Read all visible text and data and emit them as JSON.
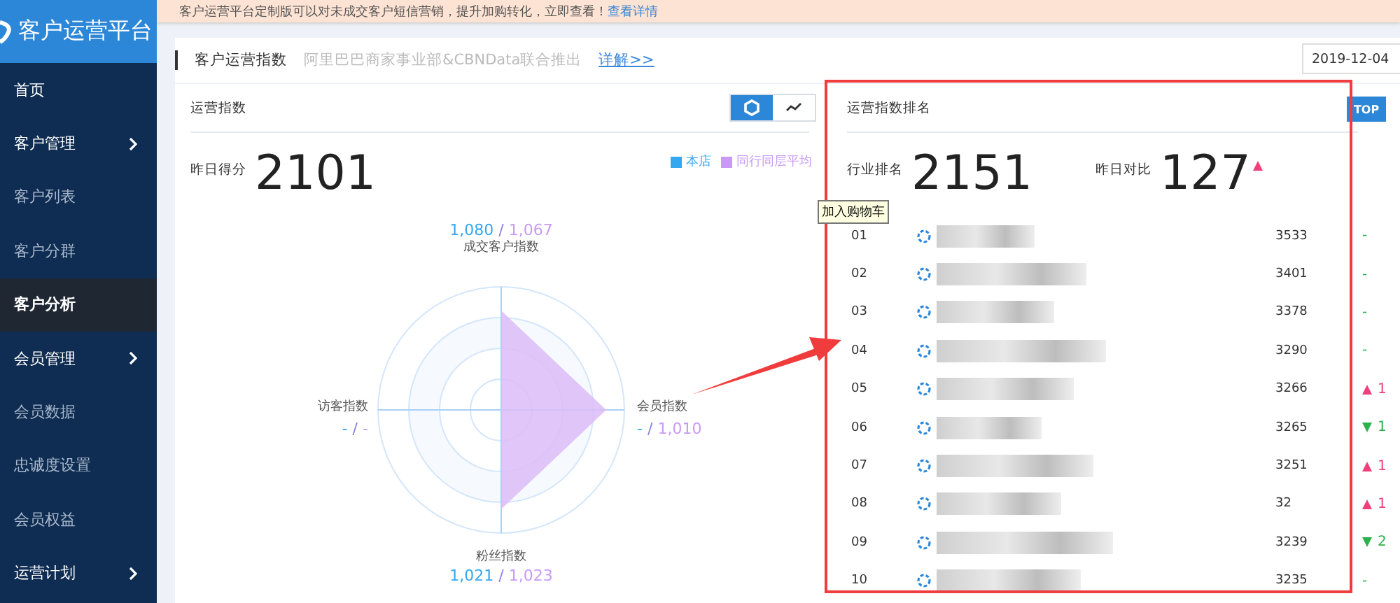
{
  "sidebar": {
    "title": "客户运营平台",
    "items": [
      {
        "label": "首页",
        "kind": "top",
        "expandable": false,
        "selected": false
      },
      {
        "label": "客户管理",
        "kind": "top",
        "expandable": true,
        "selected": false
      },
      {
        "label": "客户列表",
        "kind": "sub",
        "expandable": false,
        "selected": false
      },
      {
        "label": "客户分群",
        "kind": "sub",
        "expandable": false,
        "selected": false
      },
      {
        "label": "客户分析",
        "kind": "sub",
        "expandable": false,
        "selected": true
      },
      {
        "label": "会员管理",
        "kind": "top",
        "expandable": true,
        "selected": false
      },
      {
        "label": "会员数据",
        "kind": "sub",
        "expandable": false,
        "selected": false
      },
      {
        "label": "忠诚度设置",
        "kind": "sub",
        "expandable": false,
        "selected": false
      },
      {
        "label": "会员权益",
        "kind": "sub",
        "expandable": false,
        "selected": false
      },
      {
        "label": "运营计划",
        "kind": "top",
        "expandable": true,
        "selected": false
      }
    ]
  },
  "banner": {
    "text": "客户运营平台定制版可以对未成交客户短信营销，提升加购转化，立即查看！",
    "link": "查看详情"
  },
  "header": {
    "title": "客户运营指数",
    "subtitle": "阿里巴巴商家事业部&CBNData联合推出",
    "link": "详解>>",
    "date": "2019-12-04"
  },
  "index_panel": {
    "title": "运营指数",
    "view_toggle": [
      {
        "kind": "radar",
        "selected": true
      },
      {
        "kind": "line",
        "selected": false
      }
    ],
    "score_label": "昨日得分",
    "score": "2101",
    "legend": [
      {
        "label": "本店",
        "color": "#35a7f0"
      },
      {
        "label": "同行同层平均",
        "color": "#c99af5"
      }
    ],
    "axes": [
      {
        "kind": "top",
        "label": "成交客户指数",
        "shop": "1,080",
        "separator": "/",
        "peer": "1,067"
      },
      {
        "kind": "left",
        "label": "访客指数",
        "shop": "-",
        "separator": "/",
        "peer": "-"
      },
      {
        "kind": "right",
        "label": "会员指数",
        "shop": "-",
        "separator": "/",
        "peer": "1,010"
      },
      {
        "kind": "bottom",
        "label": "粉丝指数",
        "shop": "1,021",
        "separator": "/",
        "peer": "1,023"
      }
    ]
  },
  "rank_panel": {
    "title": "运营指数排名",
    "top_button": {
      "label": "TOP",
      "selected": true
    },
    "rank_label": "行业排名",
    "rank": "2151",
    "compare_label": "昨日对比",
    "compare": "127",
    "compare_up": true,
    "rows": [
      {
        "rank": "01",
        "score": "3533",
        "kind": "none",
        "change": "-"
      },
      {
        "rank": "02",
        "score": "3401",
        "kind": "none",
        "change": "-"
      },
      {
        "rank": "03",
        "score": "3378",
        "kind": "none",
        "change": "-"
      },
      {
        "rank": "04",
        "score": "3290",
        "kind": "none",
        "change": "-"
      },
      {
        "rank": "05",
        "score": "3266",
        "kind": "up",
        "change": "1"
      },
      {
        "rank": "06",
        "score": "3265",
        "kind": "down",
        "change": "1"
      },
      {
        "rank": "07",
        "score": "3251",
        "kind": "up",
        "change": "1"
      },
      {
        "rank": "08",
        "score": "32",
        "kind": "up",
        "change": "1"
      },
      {
        "rank": "09",
        "score": "3239",
        "kind": "down",
        "change": "2"
      },
      {
        "rank": "10",
        "score": "3235",
        "kind": "none",
        "change": "-"
      }
    ]
  },
  "tooltip": {
    "text": "加入购物车"
  }
}
